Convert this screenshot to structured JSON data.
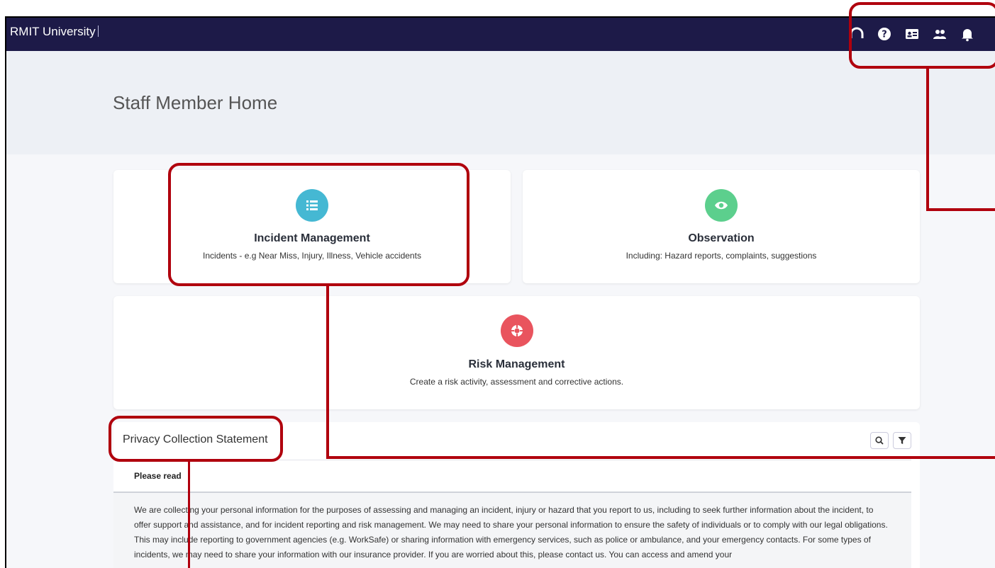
{
  "brand": "RMIT University",
  "page_title": "Staff Member Home",
  "top_icons": [
    "headset-icon",
    "help-icon",
    "id-card-icon",
    "people-icon",
    "bell-icon"
  ],
  "cards": {
    "incident": {
      "title": "Incident Management",
      "desc": "Incidents - e.g Near Miss, Injury, Illness, Vehicle accidents",
      "icon": "list-icon",
      "color": "#45b8d3"
    },
    "observation": {
      "title": "Observation",
      "desc": "Including: Hazard reports, complaints, suggestions",
      "icon": "eye-icon",
      "color": "#5ccf8d"
    },
    "risk": {
      "title": "Risk Management",
      "desc": "Create a risk activity, assessment and corrective actions.",
      "icon": "lifebuoy-icon",
      "color": "#e9545e"
    }
  },
  "privacy": {
    "title": "Privacy Collection Statement",
    "subheading": "Please read",
    "tools": [
      "search-icon",
      "filter-icon"
    ],
    "body": "We are collecting your personal information for the purposes of assessing and managing an incident, injury or hazard that you report to us, including to seek further information about the incident, to offer support and assistance, and for incident reporting and risk management. We may need to share your personal information to ensure the safety of individuals or to comply with our legal obligations. This may include reporting to government agencies (e.g. WorkSafe) or sharing information with emergency services, such as police or ambulance, and your emergency contacts. For some types of incidents, we may need to share your information with our insurance provider. If you are worried about this, please contact us. You can access and amend your"
  },
  "colors": {
    "topbar": "#1d1a48",
    "callout": "#b0000d"
  }
}
